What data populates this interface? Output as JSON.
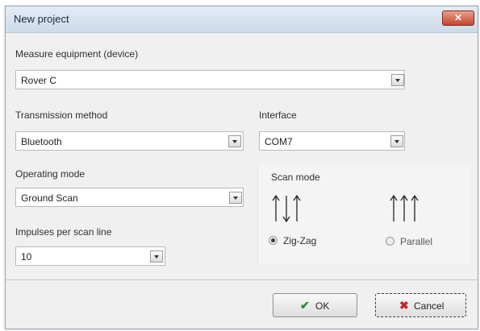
{
  "dialog": {
    "title": "New project",
    "close_label": "✕"
  },
  "device": {
    "label": "Measure equipment (device)",
    "value": "Rover C"
  },
  "transmission": {
    "label": "Transmission method",
    "value": "Bluetooth"
  },
  "interface": {
    "label": "Interface",
    "value": "COM7"
  },
  "operating": {
    "label": "Operating mode",
    "value": "Ground Scan"
  },
  "impulses": {
    "label": "Impulses per scan line",
    "value": "10"
  },
  "scan_mode": {
    "label": "Scan mode",
    "options": [
      {
        "label": "Zig-Zag",
        "selected": true,
        "icon": "zigzag-arrows-icon"
      },
      {
        "label": "Parallel",
        "selected": false,
        "icon": "parallel-arrows-icon"
      }
    ]
  },
  "buttons": {
    "ok_label": "OK",
    "cancel_label": "Cancel"
  },
  "colors": {
    "ok_check": "#2e8b2e",
    "cancel_x": "#c0282a"
  }
}
